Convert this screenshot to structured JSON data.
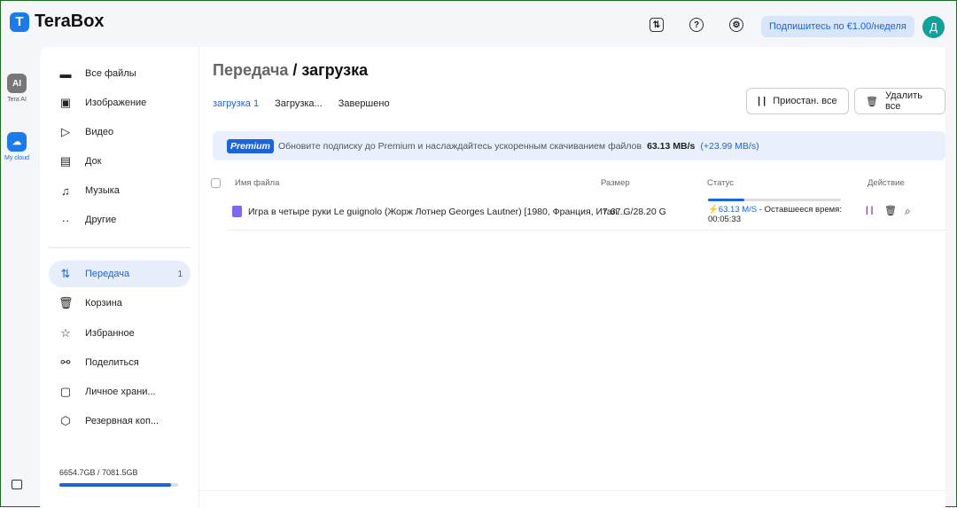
{
  "app": {
    "name": "TeraBox",
    "logo_letter": "T"
  },
  "header": {
    "subscribe": "Подпишитесь по €1.00/неделя",
    "avatar": "Д"
  },
  "rail": [
    {
      "label": "Tera AI",
      "icon": "AI"
    },
    {
      "label": "My cloud",
      "icon": "☁"
    }
  ],
  "sidebar": {
    "items": [
      {
        "label": "Все файлы",
        "icon": "▬"
      },
      {
        "label": "Изображение",
        "icon": "▣"
      },
      {
        "label": "Видео",
        "icon": "▷"
      },
      {
        "label": "Док",
        "icon": "▤"
      },
      {
        "label": "Музыка",
        "icon": "♫"
      },
      {
        "label": "Другие",
        "icon": "··"
      }
    ],
    "items2": [
      {
        "label": "Передача",
        "icon": "⇅",
        "count": "1"
      },
      {
        "label": "Корзина",
        "icon": "🗑"
      },
      {
        "label": "Избранное",
        "icon": "☆"
      },
      {
        "label": "Поделиться",
        "icon": "⚯"
      },
      {
        "label": "Личное храни...",
        "icon": "▢"
      },
      {
        "label": "Резервная коп...",
        "icon": "⬡"
      }
    ],
    "quota": "6654.7GB / 7081.5GB",
    "quota_fraction": 0.94
  },
  "main": {
    "title_a": "Передача",
    "title_b": " / загрузка",
    "tabs": [
      "загрузка 1",
      "Загрузка...",
      "Завершено"
    ],
    "pause_all": "Приостан. все",
    "delete_all": "Удалить все",
    "banner": {
      "badge": "Premium",
      "text": "Обновите подписку до Premium и наслаждайтесь ускоренным скачиванием файлов",
      "speed": "63.13 MB/s",
      "boost": "(+23.99 MB/s)"
    },
    "columns": [
      "Имя файла",
      "Размер",
      "Статус",
      "Действие"
    ],
    "rows": [
      {
        "name": "Игра в четыре руки Le guignolo (Жорж Лотнер Georges Lautner) [1980, Франция, Итал...",
        "size": "7.67 G/28.20 G",
        "speed": "63.13 M/S",
        "remaining": "- Оставшееся время:",
        "time": "00:05:33",
        "progress": 0.27
      }
    ]
  }
}
